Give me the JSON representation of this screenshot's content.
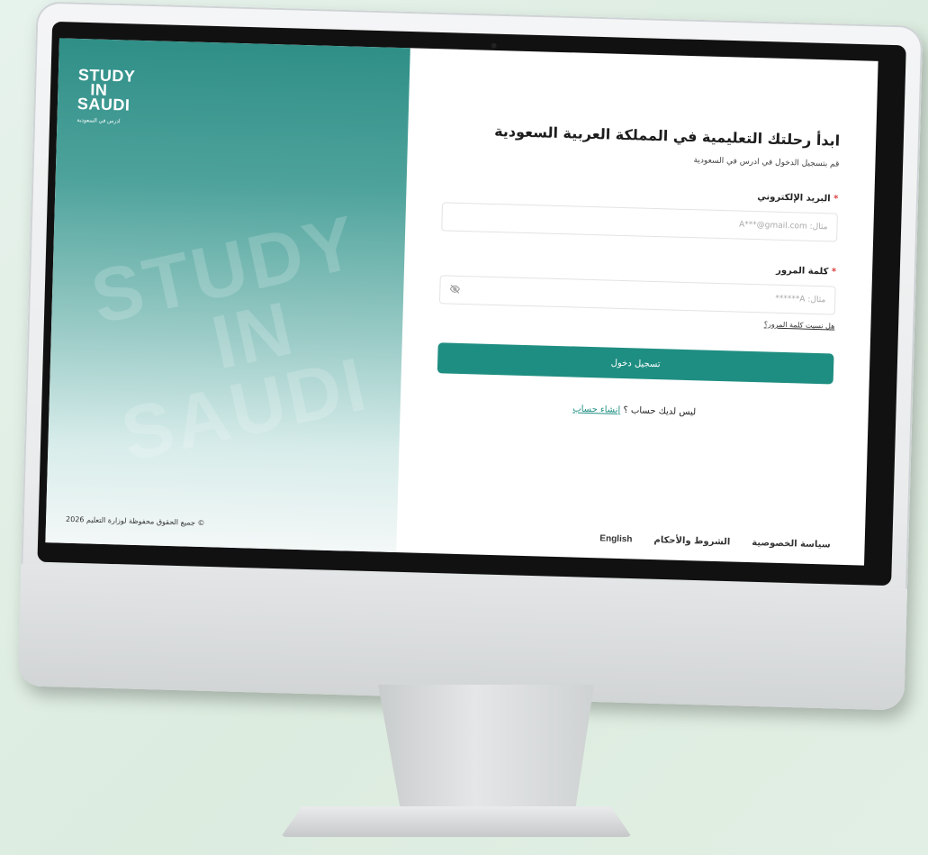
{
  "logo": {
    "line1": "STUDY",
    "line2": "IN",
    "line3": "SAUDI",
    "tagline": "ادرس في السعودية"
  },
  "watermark": {
    "line1": "STUDY",
    "line2": "IN",
    "line3": "SAUDI"
  },
  "copyright": "جميع الحقوق محفوظة لوزارة التعليم 2026 ©",
  "form": {
    "title": "ابدأ رحلتك التعليمية في المملكة العربية السعودية",
    "subtitle": "قم بتسجيل الدخول في ادرس في السعودية",
    "email_label": "البريد الإلكتروني",
    "email_placeholder": "مثال: A***@gmail.com",
    "password_label": "كلمة المرور",
    "password_placeholder": "مثال: A******",
    "required_mark": "*",
    "forgot_password": "هل نسيت كلمة المرور؟",
    "login_button": "تسجيل دخول",
    "no_account_text": "ليس لديك حساب ؟",
    "create_account": "إنشاء حساب"
  },
  "footer": {
    "english": "English",
    "terms": "الشروط والأحكام",
    "privacy": "سياسة الخصوصية"
  },
  "colors": {
    "accent": "#1f8e82",
    "panel_top": "#2f8f87"
  },
  "icons": {
    "password_toggle": "eye-off-icon"
  }
}
